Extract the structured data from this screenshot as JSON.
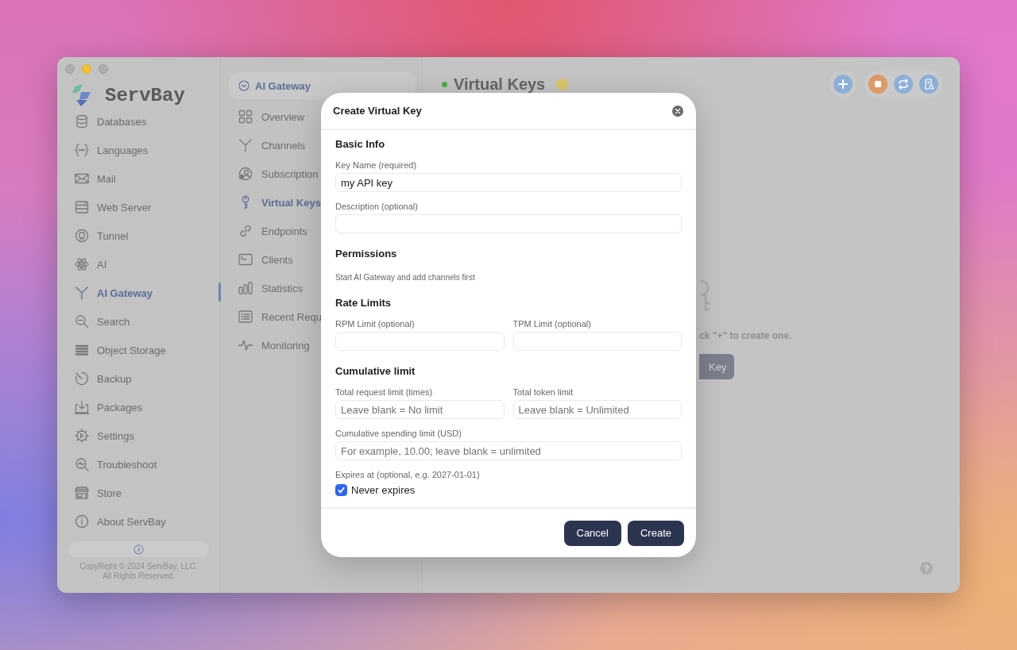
{
  "sidebar": {
    "logo": "ServBay",
    "items": [
      {
        "label": "Databases",
        "selected": false
      },
      {
        "label": "Languages",
        "selected": false
      },
      {
        "label": "Mail",
        "selected": false
      },
      {
        "label": "Web Server",
        "selected": false
      },
      {
        "label": "Tunnel",
        "selected": false
      },
      {
        "label": "AI",
        "selected": false
      },
      {
        "label": "AI Gateway",
        "selected": true
      },
      {
        "label": "Search",
        "selected": false
      },
      {
        "label": "Object Storage",
        "selected": false
      },
      {
        "label": "Backup",
        "selected": false
      },
      {
        "label": "Packages",
        "selected": false
      },
      {
        "label": "Settings",
        "selected": false
      },
      {
        "label": "Troubleshoot",
        "selected": false
      },
      {
        "label": "Store",
        "selected": false
      },
      {
        "label": "About ServBay",
        "selected": false
      }
    ],
    "copyright": [
      "CopyRight © 2024 ServBay, LLC.",
      "All Rights Reserved."
    ]
  },
  "subnav": {
    "header": "AI Gateway",
    "items": [
      {
        "label": "Overview",
        "selected": false
      },
      {
        "label": "Channels",
        "selected": false
      },
      {
        "label": "Subscription",
        "selected": false
      },
      {
        "label": "Virtual Keys",
        "selected": true
      },
      {
        "label": "Endpoints",
        "selected": false
      },
      {
        "label": "Clients",
        "selected": false
      },
      {
        "label": "Statistics",
        "selected": false
      },
      {
        "label": "Recent Requ",
        "selected": false
      },
      {
        "label": "Monitoring",
        "selected": false
      }
    ]
  },
  "main": {
    "title": "Virtual Keys",
    "empty_hint": "ck \"+\" to create one.",
    "empty_button": "Key",
    "help": "?"
  },
  "dialog": {
    "title": "Create Virtual Key",
    "sections": [
      {
        "heading": "Basic Info",
        "items": [
          {
            "kind": "fields",
            "fields": [
              {
                "label": "Key Name (required)",
                "value": "my API key"
              }
            ]
          },
          {
            "kind": "fields",
            "fields": [
              {
                "label": "Description (optional)"
              }
            ]
          }
        ]
      },
      {
        "heading": "Permissions",
        "items": [
          {
            "kind": "note",
            "text": "Start AI Gateway and add channels first"
          }
        ]
      },
      {
        "heading": "Rate Limits",
        "items": [
          {
            "kind": "fields",
            "fields": [
              {
                "label": "RPM Limit (optional)"
              },
              {
                "label": "TPM Limit (optional)"
              }
            ]
          }
        ]
      },
      {
        "heading": "Cumulative limit",
        "items": [
          {
            "kind": "fields",
            "fields": [
              {
                "label": "Total request limit (times)",
                "placeholder": "Leave blank = No limit"
              },
              {
                "label": "Total token limit",
                "placeholder": "Leave blank = Unlimited"
              }
            ]
          },
          {
            "kind": "fields",
            "fields": [
              {
                "label": "Cumulative spending limit (USD)",
                "placeholder": "For example, 10.00; leave blank = unlimited"
              }
            ]
          },
          {
            "kind": "caption",
            "text": "Expires at (optional, e.g. 2027-01-01)"
          },
          {
            "kind": "checkbox",
            "label": "Never expires",
            "checked": true
          }
        ]
      }
    ],
    "buttons": [
      "Cancel",
      "Create"
    ]
  }
}
